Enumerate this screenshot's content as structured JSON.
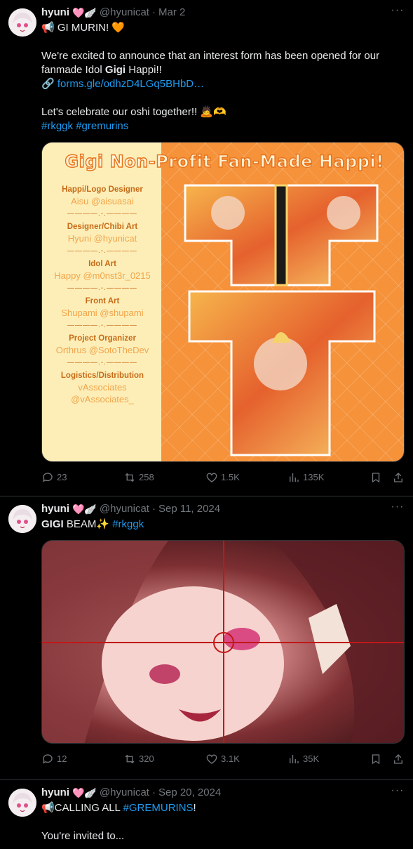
{
  "tweets": [
    {
      "name": "hyuni",
      "emoji": "🩷🪽",
      "handle": "@hyunicat",
      "date": "Mar 2",
      "lines": [
        "📢 GI MURIN! 🧡",
        "",
        "We're excited to announce that an interest form has been opened for our",
        "fanmade Idol ",
        "🔗 forms.gle/odhzD4LGq5BHbD…",
        "",
        "Let's celebrate our oshi together!! 🙇🫶"
      ],
      "line4_bold": "Gigi",
      "line4_end": " Happi!!",
      "link": "forms.gle/odhzD4LGq5BHbD…",
      "hashtags": "#rkggk #gremurins",
      "image": {
        "title": "Gigi Non-Profit Fan-Made Happi!",
        "credits": [
          {
            "role": "Happi/Logo Designer",
            "names": [
              "Aisu @aisuasai"
            ]
          },
          {
            "role": "Designer/Chibi Art",
            "names": [
              "Hyuni @hyunicat"
            ]
          },
          {
            "role": "Idol Art",
            "names": [
              "Happy @m0nst3r_0215"
            ]
          },
          {
            "role": "Front Art",
            "names": [
              "Shupami @shupami"
            ]
          },
          {
            "role": "Project Organizer",
            "names": [
              "Orthrus @SotoTheDev"
            ]
          },
          {
            "role": "Logistics/Distribution",
            "names": [
              "vAssociates",
              "@vAssociates_"
            ]
          }
        ],
        "separator": "————.-.————"
      },
      "stats": {
        "replies": "23",
        "reposts": "258",
        "likes": "1.5K",
        "views": "135K"
      }
    },
    {
      "name": "hyuni",
      "emoji": "🩷🪽",
      "handle": "@hyunicat",
      "date": "Sep 11, 2024",
      "text_bold": "GIGI",
      "text_rest": " BEAM✨ ",
      "hashtag": "#rkggk",
      "stats": {
        "replies": "12",
        "reposts": "320",
        "likes": "3.1K",
        "views": "35K"
      }
    },
    {
      "name": "hyuni",
      "emoji": "🩷🪽",
      "handle": "@hyunicat",
      "date": "Sep 20, 2024",
      "text_start": "📢CALLING ALL ",
      "hashtag": "#GREMURINS",
      "text_end": "!",
      "line3": "You're invited to..."
    }
  ],
  "more_glyph": "···",
  "dot": "·",
  "colors": {
    "background": "#000000",
    "link": "#1d9bf0",
    "muted": "#71767b",
    "border": "#2f3336",
    "happi_orange": "#f5923a"
  }
}
